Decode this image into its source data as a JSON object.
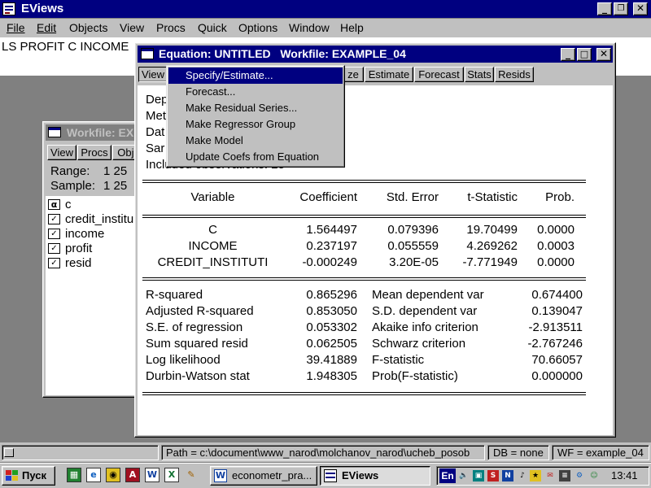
{
  "app": {
    "title": "EViews",
    "menu": [
      "File",
      "Edit",
      "Objects",
      "View",
      "Procs",
      "Quick",
      "Options",
      "Window",
      "Help"
    ],
    "command_text": "LS PROFIT  C INCOME"
  },
  "workfile_window": {
    "title": "Workfile: EX",
    "toolbar": [
      "View",
      "Procs",
      "Obje"
    ],
    "range_label": "Range:",
    "range_value": "1 25",
    "sample_label": "Sample:",
    "sample_value": "1 25",
    "objects": [
      {
        "icon": "alpha-icon",
        "name": "c"
      },
      {
        "icon": "series-icon",
        "name": "credit_institu"
      },
      {
        "icon": "series-icon",
        "name": "income"
      },
      {
        "icon": "series-icon",
        "name": "profit"
      },
      {
        "icon": "series-icon",
        "name": "resid"
      }
    ]
  },
  "equation_window": {
    "title": "Equation: UNTITLED   Workfile: EXAMPLE_04",
    "toolbar": [
      "View",
      "ze",
      "Estimate",
      "Forecast",
      "Stats",
      "Resids"
    ],
    "header_lines": [
      "Dep",
      "Met",
      "Dat",
      "Sar",
      "Included observations: 25"
    ],
    "table_headers": [
      "Variable",
      "Coefficient",
      "Std. Error",
      "t-Statistic",
      "Prob."
    ],
    "rows": [
      [
        "C",
        "1.564497",
        "0.079396",
        "19.70499",
        "0.0000"
      ],
      [
        "INCOME",
        "0.237197",
        "0.055559",
        "4.269262",
        "0.0003"
      ],
      [
        "CREDIT_INSTITUTI",
        "-0.000249",
        "3.20E-05",
        "-7.771949",
        "0.0000"
      ]
    ],
    "stats": [
      [
        "R-squared",
        "0.865296",
        "Mean dependent var",
        "0.674400"
      ],
      [
        "Adjusted R-squared",
        "0.853050",
        "S.D. dependent var",
        "0.139047"
      ],
      [
        "S.E. of regression",
        "0.053302",
        "Akaike info criterion",
        "-2.913511"
      ],
      [
        "Sum squared resid",
        "0.062505",
        "Schwarz criterion",
        "-2.767246"
      ],
      [
        "Log likelihood",
        "39.41889",
        "F-statistic",
        "70.66057"
      ],
      [
        "Durbin-Watson stat",
        "1.948305",
        "Prob(F-statistic)",
        "0.000000"
      ]
    ]
  },
  "dropdown": {
    "items": [
      "Specify/Estimate...",
      "Forecast...",
      "Make Residual Series...",
      "Make Regressor Group",
      "Make Model",
      "Update Coefs from Equation"
    ],
    "selected_index": 0
  },
  "status_bar": {
    "path": "Path = c:\\document\\www_narod\\molchanov_narod\\ucheb_posob",
    "db": "DB = none",
    "wf": "WF = example_04"
  },
  "taskbar": {
    "start_label": "Пуск",
    "quick_launch": [
      "excel-icon",
      "ie-icon",
      "media-icon",
      "access-icon",
      "word-icon",
      "excel-sheet-icon",
      "pen-icon"
    ],
    "tasks": [
      {
        "icon": "word-icon",
        "label": "econometr_pra...",
        "active": false
      },
      {
        "icon": "eviews-icon",
        "label": "EViews",
        "active": true
      }
    ],
    "language": "En",
    "clock": "13:41"
  },
  "colors": {
    "title_active": "#000080",
    "title_inactive": "#808080",
    "face": "#c0c0c0",
    "selection": "#000080"
  }
}
